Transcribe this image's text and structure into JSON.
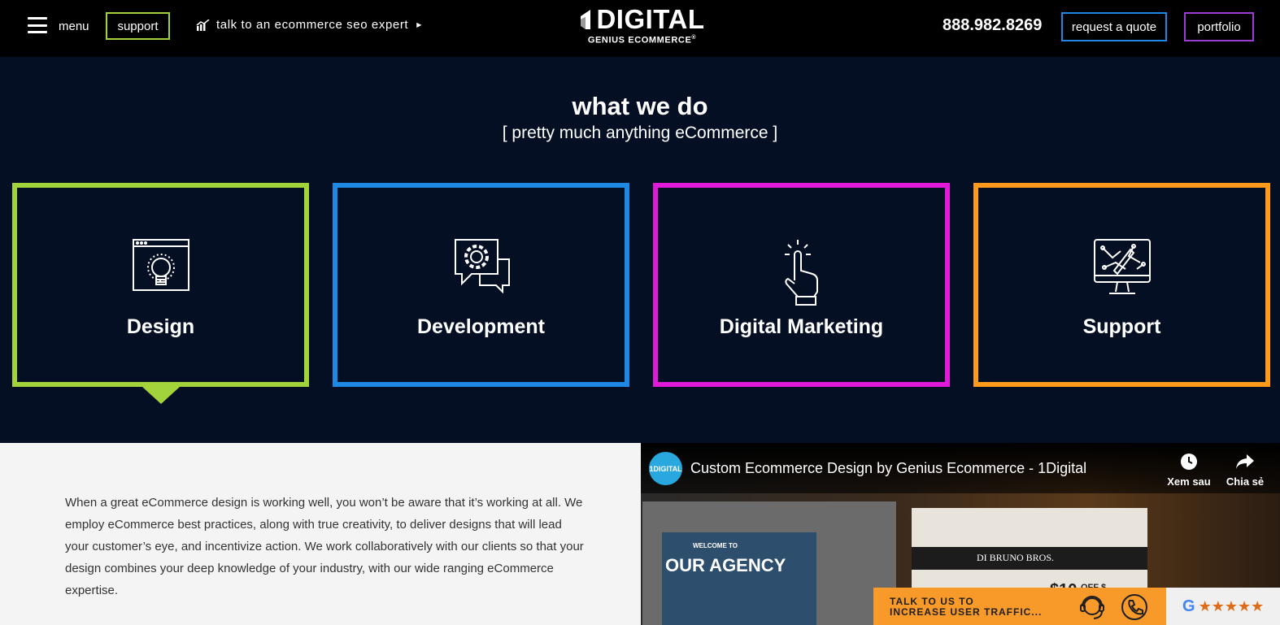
{
  "header": {
    "menu_label": "menu",
    "support_label": "support",
    "expert_label": "talk to an ecommerce seo expert",
    "logo_main": "DIGITAL",
    "logo_sub": "GENIUS ECOMMERCE",
    "logo_registered": "®",
    "phone": "888.982.8269",
    "quote_label": "request a quote",
    "portfolio_label": "portfolio"
  },
  "section": {
    "title": "what we do",
    "subtitle": "[ pretty much anything eCommerce ]"
  },
  "services": [
    {
      "label": "Design",
      "icon": "lightbulb-window-icon",
      "color": "#a3d33a"
    },
    {
      "label": "Development",
      "icon": "gear-chat-icon",
      "color": "#1e88e5"
    },
    {
      "label": "Digital Marketing",
      "icon": "tap-hand-icon",
      "color": "#e11ad9"
    },
    {
      "label": "Support",
      "icon": "monitor-circuit-icon",
      "color": "#ff9a1a"
    }
  ],
  "description": "When a great eCommerce design is working well, you won’t be aware that it’s working at all. We employ eCommerce best practices, along with true creativity, to deliver designs that will lead your customer’s eye, and incentivize action. We work collaboratively with our clients so that your design combines your deep knowledge of your industry, with our wide ranging eCommerce expertise.",
  "video": {
    "channel_avatar": "1DIGITAL",
    "title": "Custom Ecommerce Design by Genius Ecommerce - 1Digital",
    "watch_later": "Xem sau",
    "share": "Chia sẻ",
    "frame_text_small": "WELCOME TO",
    "frame_text_big": "OUR AGENCY",
    "frame_brand": "DI BRUNO BROS.",
    "frame_price": "$10",
    "frame_off": "OFF $"
  },
  "cta": {
    "line1": "TALK TO US TO",
    "line2": "INCREASE USER TRAFFIC..."
  },
  "google": {
    "letter": "G",
    "stars": "★★★★★"
  },
  "colors": {
    "background": "#050f24",
    "design": "#a3d33a",
    "development": "#1e88e5",
    "marketing": "#e11ad9",
    "support": "#ff9a1a",
    "cta": "#f79a2a"
  }
}
